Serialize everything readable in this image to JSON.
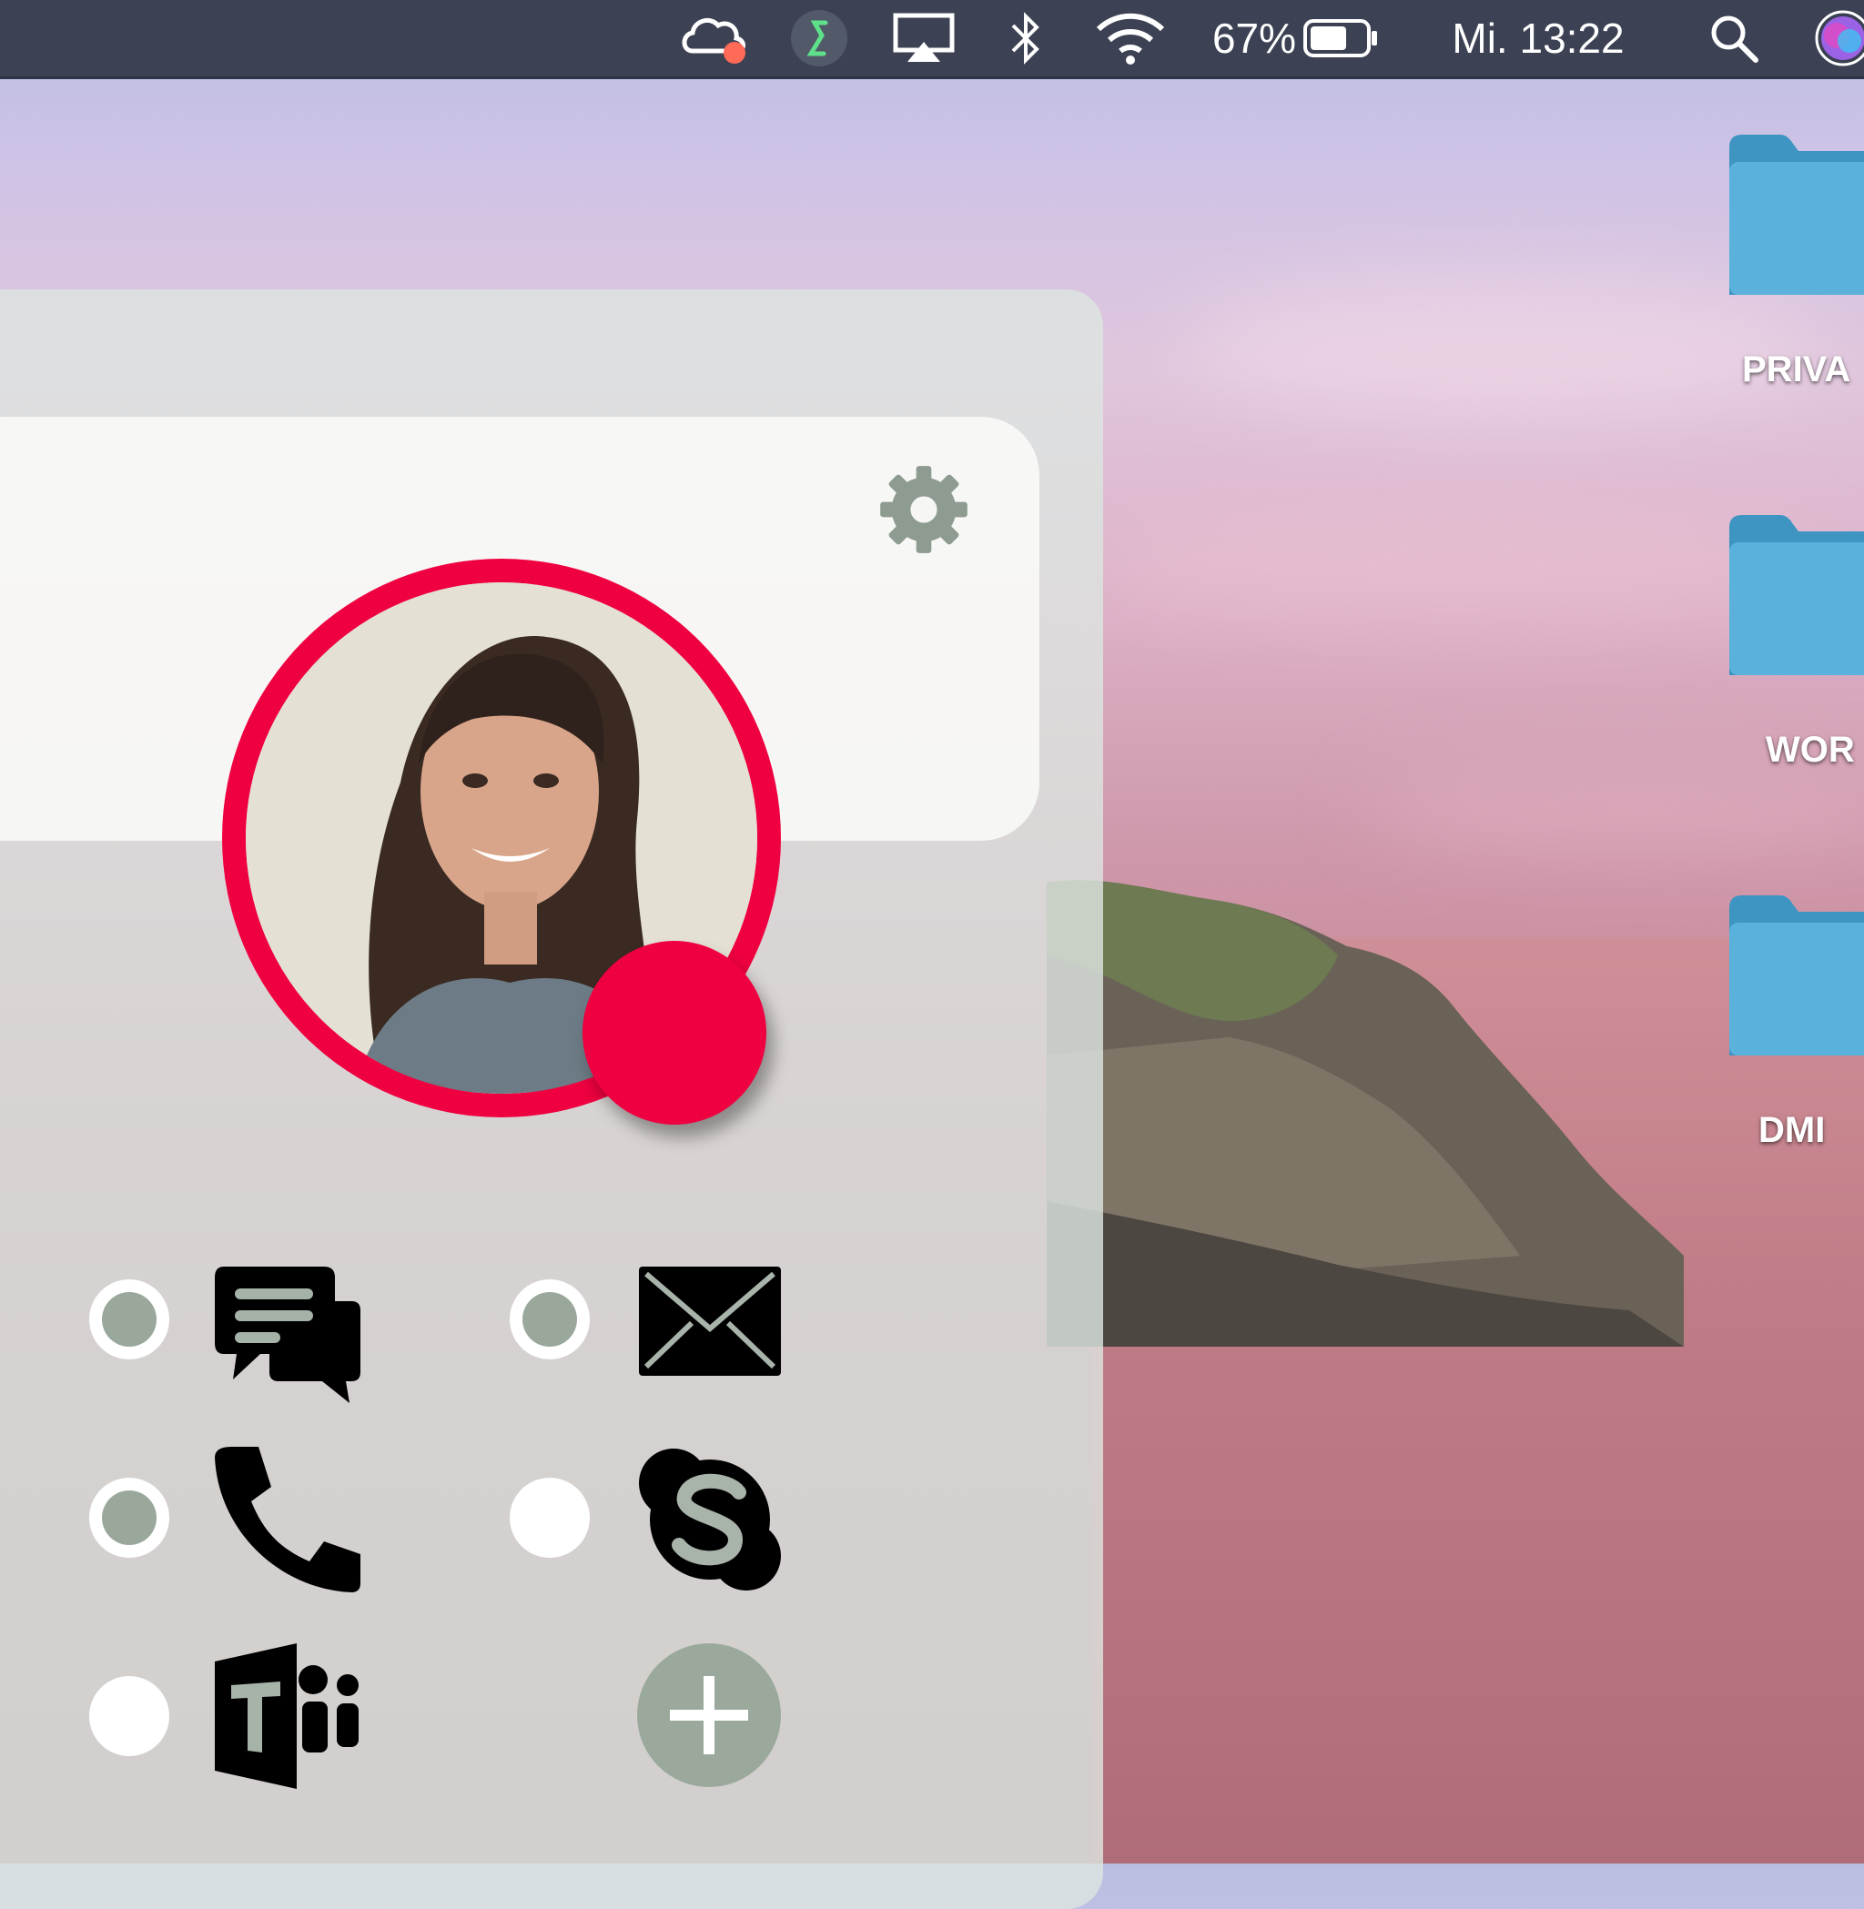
{
  "menubar": {
    "battery_percent": "67%",
    "battery_level": 0.67,
    "clock": "Mi. 13:22",
    "icons": [
      "creative-cloud-icon",
      "status-app-icon",
      "airplay-icon",
      "bluetooth-icon",
      "wifi-icon",
      "battery-icon",
      "spotlight-search-icon",
      "siri-icon"
    ]
  },
  "desktop": {
    "folders": [
      {
        "label": "PRIVA"
      },
      {
        "label": "WOR"
      },
      {
        "label": "DMI"
      }
    ],
    "folder_color": "#4fa9d6"
  },
  "widget": {
    "status_color": "#ef0040",
    "accent_color": "#9aa99c",
    "channels": [
      {
        "name": "chat",
        "icon": "chat-bubbles-icon",
        "selected": true
      },
      {
        "name": "mail",
        "icon": "mail-icon",
        "selected": true
      },
      {
        "name": "phone",
        "icon": "phone-icon",
        "selected": true
      },
      {
        "name": "skype",
        "icon": "skype-icon",
        "selected": false
      },
      {
        "name": "teams",
        "icon": "teams-icon",
        "selected": false
      }
    ],
    "add_icon": "plus-icon",
    "settings_icon": "gear-icon"
  }
}
